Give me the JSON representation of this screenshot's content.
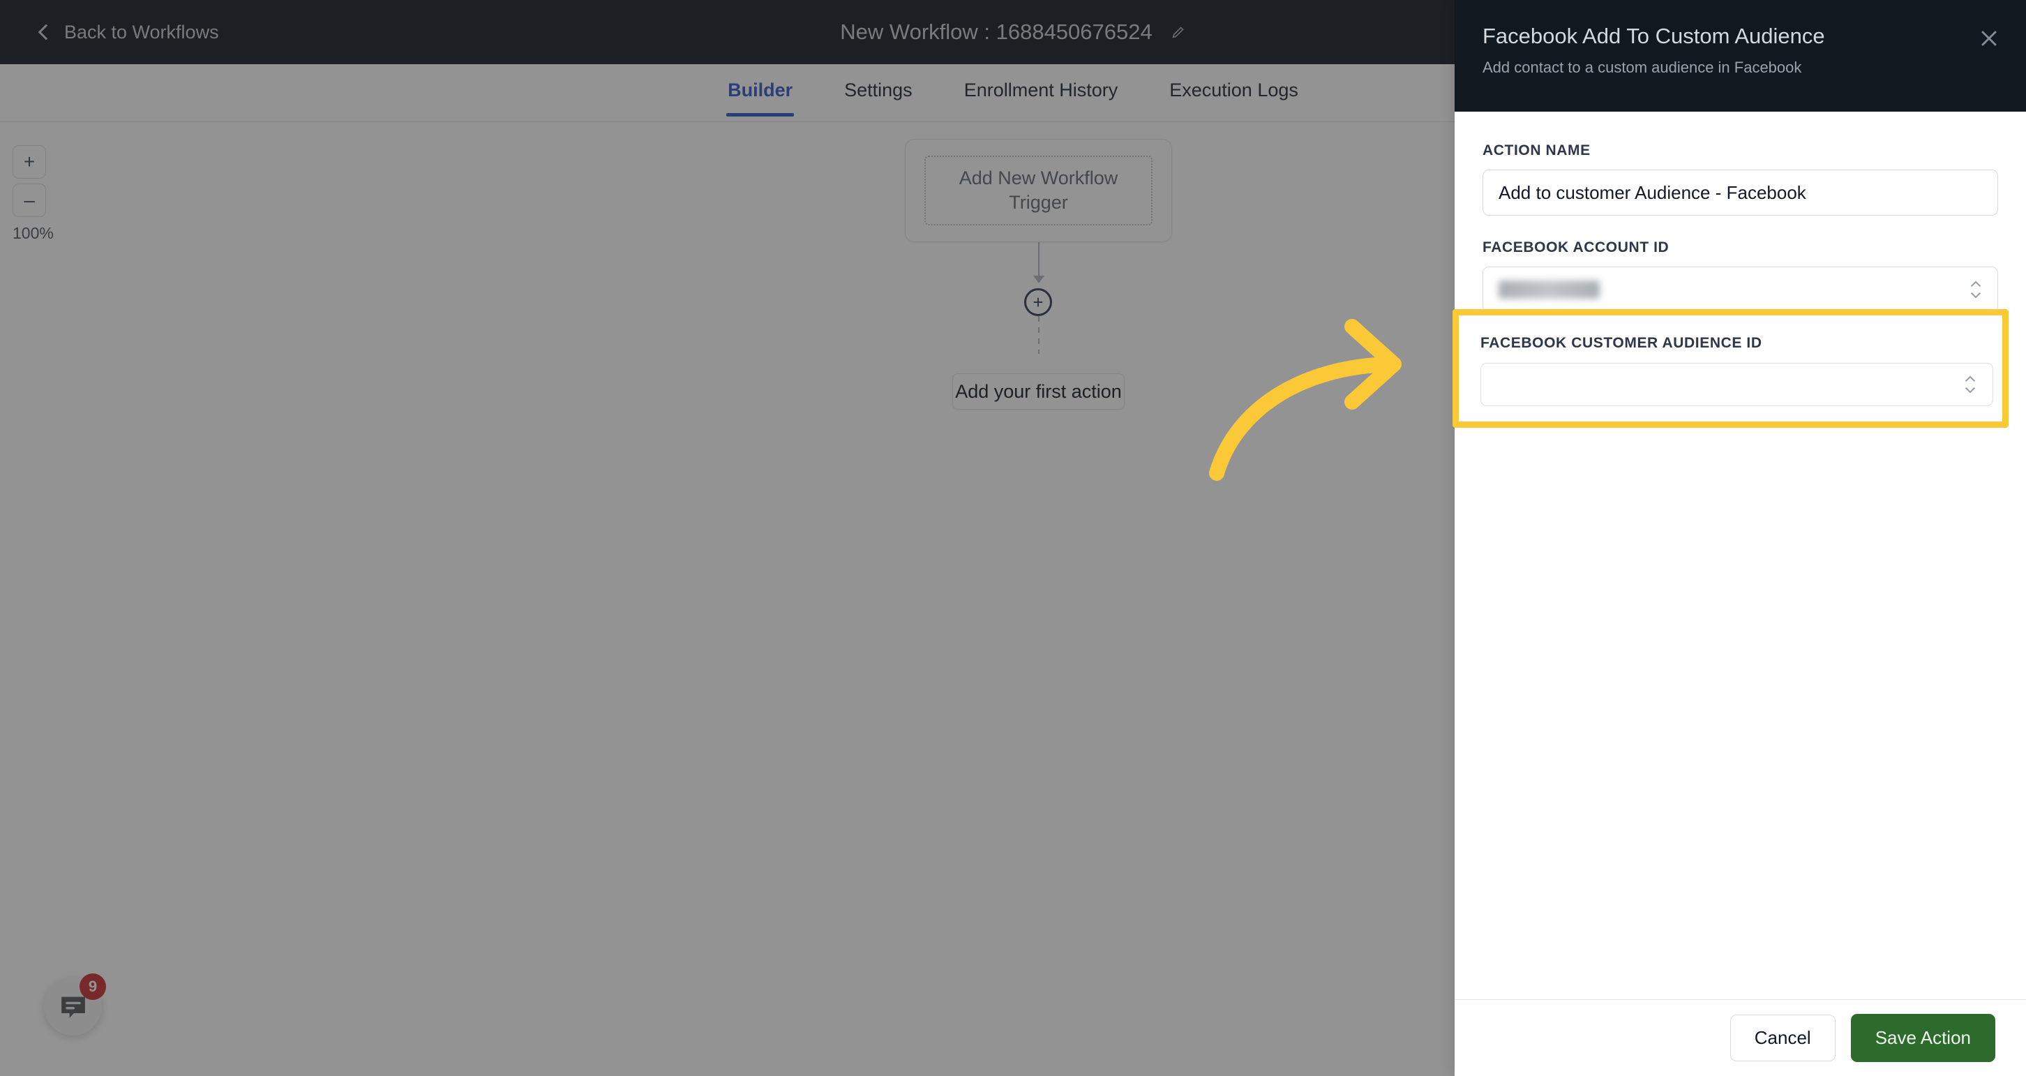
{
  "topbar": {
    "back_label": "Back to Workflows",
    "back_icon": "chevron-left-icon",
    "workflow_title": "New Workflow : 1688450676524",
    "edit_icon": "pencil-icon"
  },
  "tabs": [
    {
      "label": "Builder",
      "active": true
    },
    {
      "label": "Settings",
      "active": false
    },
    {
      "label": "Enrollment History",
      "active": false
    },
    {
      "label": "Execution Logs",
      "active": false
    }
  ],
  "canvas": {
    "zoom": {
      "in_label": "+",
      "out_label": "–",
      "percent": "100%"
    },
    "trigger_label": "Add New Workflow Trigger",
    "add_node_label": "+",
    "first_action_label": "Add your first action"
  },
  "chat": {
    "icon": "chat-bubble-icon",
    "badge_count": "9"
  },
  "panel": {
    "title": "Facebook Add To Custom Audience",
    "subtitle": "Add contact to a custom audience in Facebook",
    "close_icon": "close-icon",
    "fields": [
      {
        "label": "ACTION NAME",
        "type": "text",
        "value": "Add to customer Audience - Facebook",
        "placeholder": ""
      },
      {
        "label": "FACEBOOK ACCOUNT ID",
        "type": "select",
        "value": "",
        "redacted": true,
        "placeholder": ""
      }
    ],
    "footer": {
      "cancel_label": "Cancel",
      "save_label": "Save Action"
    }
  },
  "annotation": {
    "highlight_color": "#fbc937",
    "arrow_icon": "curved-arrow-right-icon",
    "highlighted_field": {
      "label": "FACEBOOK CUSTOMER AUDIENCE ID",
      "type": "select",
      "value": "",
      "placeholder": ""
    }
  },
  "colors": {
    "topbar_bg": "#101820",
    "accent_tab": "#2b57c4",
    "save_button": "#2c6b2b",
    "badge": "#c92b2b",
    "highlight": "#fbc937"
  }
}
